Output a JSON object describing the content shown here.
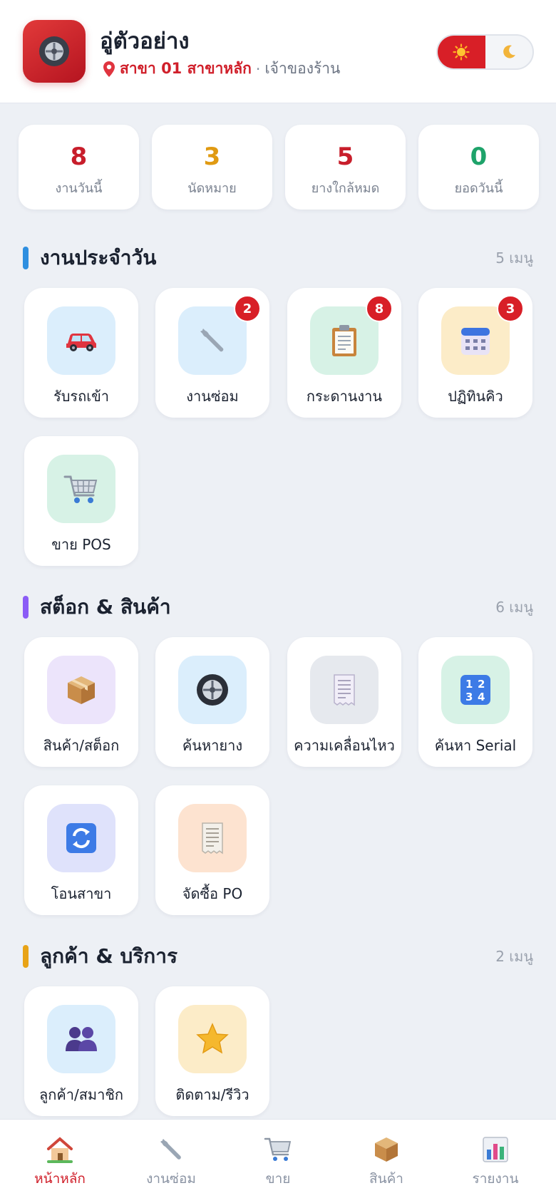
{
  "header": {
    "shop_name": "อู่ตัวอย่าง",
    "branch": "สาขา 01 สาขาหลัก",
    "separator": "·",
    "role": "เจ้าของร้าน",
    "theme_options": [
      "light",
      "dark"
    ],
    "theme_selected": "light",
    "brand_color": "#d81f27"
  },
  "stats": [
    {
      "value": "8",
      "label": "งานวันนี้",
      "color": "#c81e2b"
    },
    {
      "value": "3",
      "label": "นัดหมาย",
      "color": "#e09a12"
    },
    {
      "value": "5",
      "label": "ยางใกล้หมด",
      "color": "#c81e2b"
    },
    {
      "value": "0",
      "label": "ยอดวันนี้",
      "color": "#1ea36a"
    }
  ],
  "sections": [
    {
      "title": "งานประจำวัน",
      "count_label": "5  เมนู",
      "accent": "#2f8fe0",
      "items": [
        {
          "label": "รับรถเข้า",
          "icon": "car-icon",
          "bg": "#dbeefc"
        },
        {
          "label": "งานซ่อม",
          "icon": "wrench-icon",
          "bg": "#dbeefc",
          "badge": "2"
        },
        {
          "label": "กระดานงาน",
          "icon": "clipboard-icon",
          "bg": "#d7f2e6",
          "badge": "8"
        },
        {
          "label": "ปฏิทินคิว",
          "icon": "calendar-icon",
          "bg": "#fcecc8",
          "badge": "3"
        },
        {
          "label": "ขาย POS",
          "icon": "cart-icon",
          "bg": "#d7f2e6"
        }
      ]
    },
    {
      "title": "สต็อก & สินค้า",
      "count_label": "6  เมนู",
      "accent": "#8b5cf6",
      "items": [
        {
          "label": "สินค้า/สต็อก",
          "icon": "box-icon",
          "bg": "#ece4fb"
        },
        {
          "label": "ค้นหายาง",
          "icon": "tire-icon",
          "bg": "#dbeefc"
        },
        {
          "label": "ความเคลื่อนไหว",
          "icon": "receipt-icon",
          "bg": "#e6e9ee"
        },
        {
          "label": "ค้นหา Serial",
          "icon": "numbers-icon",
          "bg": "#d7f2e6"
        },
        {
          "label": "โอนสาขา",
          "icon": "transfer-icon",
          "bg": "#dfe2fb"
        },
        {
          "label": "จัดซื้อ PO",
          "icon": "receipt-icon",
          "bg": "#fde3d0"
        }
      ]
    },
    {
      "title": "ลูกค้า & บริการ",
      "count_label": "2  เมนู",
      "accent": "#e8a317",
      "items": [
        {
          "label": "ลูกค้า/สมาชิก",
          "icon": "people-icon",
          "bg": "#dbeefc"
        },
        {
          "label": "ติดตาม/รีวิว",
          "icon": "star-icon",
          "bg": "#fcecc8"
        }
      ]
    }
  ],
  "bottom_nav": [
    {
      "label": "หน้าหลัก",
      "icon": "home-icon",
      "active": true
    },
    {
      "label": "งานซ่อม",
      "icon": "wrench-icon",
      "active": false
    },
    {
      "label": "ขาย",
      "icon": "cart-icon",
      "active": false
    },
    {
      "label": "สินค้า",
      "icon": "box-icon",
      "active": false
    },
    {
      "label": "รายงาน",
      "icon": "chart-icon",
      "active": false
    }
  ]
}
